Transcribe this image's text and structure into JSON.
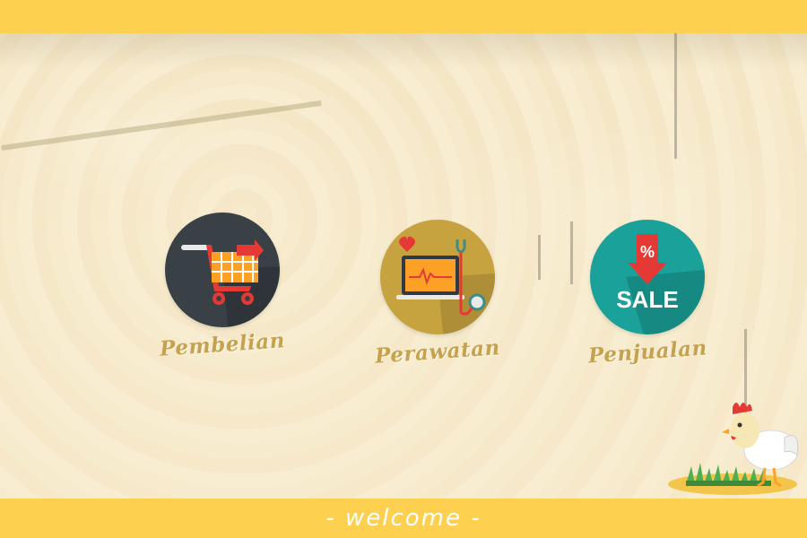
{
  "menu": {
    "items": [
      {
        "label": "Pembelian",
        "icon": "shopping-cart-icon",
        "color": "#394046"
      },
      {
        "label": "Perawatan",
        "icon": "laptop-stethoscope-icon",
        "color": "#c7a33f"
      },
      {
        "label": "Penjualan",
        "icon": "sale-tag-icon",
        "color": "#1aa19a",
        "badge_text": "SALE",
        "badge_symbol": "%"
      }
    ]
  },
  "footer": {
    "welcome_text": "- welcome -"
  },
  "colors": {
    "bar": "#fdd04f",
    "label": "#c6a24f"
  }
}
